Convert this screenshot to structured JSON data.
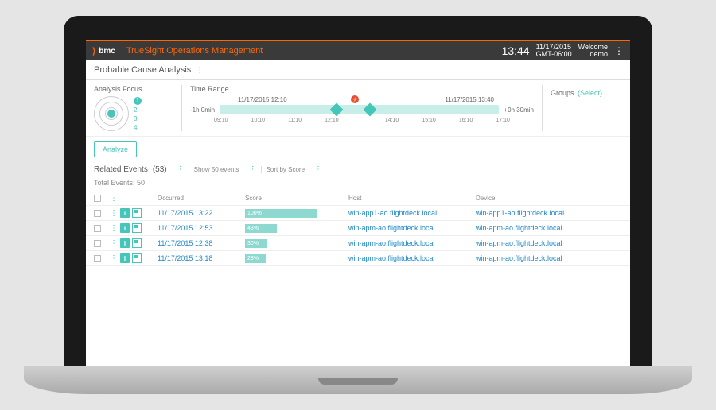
{
  "header": {
    "logo_brand": "bmc",
    "app_title": "TrueSight Operations Management",
    "clock": "13:44",
    "date": "11/17/2015",
    "tz": "GMT-06:00",
    "welcome": "Welcome",
    "user": "demo"
  },
  "page": {
    "title": "Probable Cause Analysis"
  },
  "analysis": {
    "focus_label": "Analysis Focus",
    "focus_levels": [
      "1",
      "2",
      "3",
      "4"
    ],
    "time_label": "Time Range",
    "start_time": "11/17/2015 12:10",
    "end_time": "11/17/2015 13:40",
    "left_offset": "-1h 0min",
    "right_offset": "+0h 30min",
    "ticks": [
      "09:10",
      "10:10",
      "11:10",
      "12:10",
      "",
      "14:10",
      "15:10",
      "16:10",
      "17:10"
    ],
    "groups_label": "Groups",
    "groups_select": "(Select)"
  },
  "analyze_btn": "Analyze",
  "related": {
    "title": "Related Events",
    "count": "(53)",
    "show_link": "Show 50 events",
    "sort_link": "Sort by Score",
    "total": "Total Events: 50",
    "columns": {
      "occurred": "Occurred",
      "score": "Score",
      "host": "Host",
      "device": "Device"
    },
    "rows": [
      {
        "occurred": "11/17/2015 13:22",
        "score": "100%",
        "score_w": 90,
        "host": "win-app1-ao.flightdeck.local",
        "device": "win-app1-ao.flightdeck.local"
      },
      {
        "occurred": "11/17/2015 12:53",
        "score": "43%",
        "score_w": 40,
        "host": "win-apm-ao.flightdeck.local",
        "device": "win-apm-ao.flightdeck.local"
      },
      {
        "occurred": "11/17/2015 12:38",
        "score": "30%",
        "score_w": 28,
        "host": "win-apm-ao.flightdeck.local",
        "device": "win-apm-ao.flightdeck.local"
      },
      {
        "occurred": "11/17/2015 13:18",
        "score": "28%",
        "score_w": 26,
        "host": "win-apm-ao.flightdeck.local",
        "device": "win-apm-ao.flightdeck.local"
      }
    ]
  }
}
